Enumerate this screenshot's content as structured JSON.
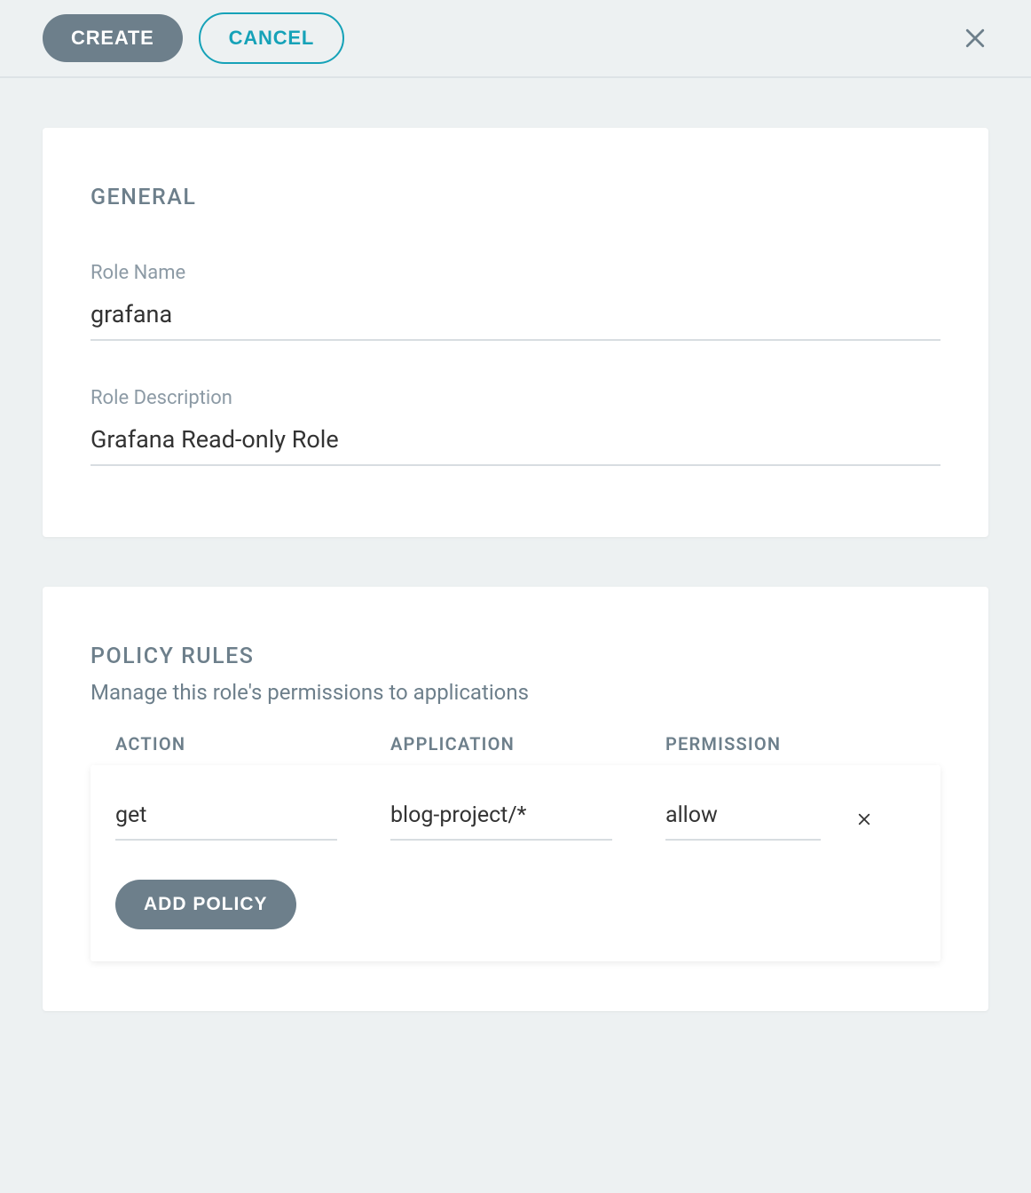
{
  "header": {
    "create_label": "CREATE",
    "cancel_label": "CANCEL"
  },
  "general": {
    "title": "GENERAL",
    "role_name_label": "Role Name",
    "role_name_value": "grafana",
    "role_desc_label": "Role Description",
    "role_desc_value": "Grafana Read-only Role"
  },
  "policy": {
    "title": "POLICY RULES",
    "subtitle": "Manage this role's permissions to applications",
    "columns": {
      "action": "ACTION",
      "application": "APPLICATION",
      "permission": "PERMISSION"
    },
    "rows": [
      {
        "action": "get",
        "application": "blog-project/*",
        "permission": "allow"
      }
    ],
    "add_label": "ADD POLICY"
  }
}
